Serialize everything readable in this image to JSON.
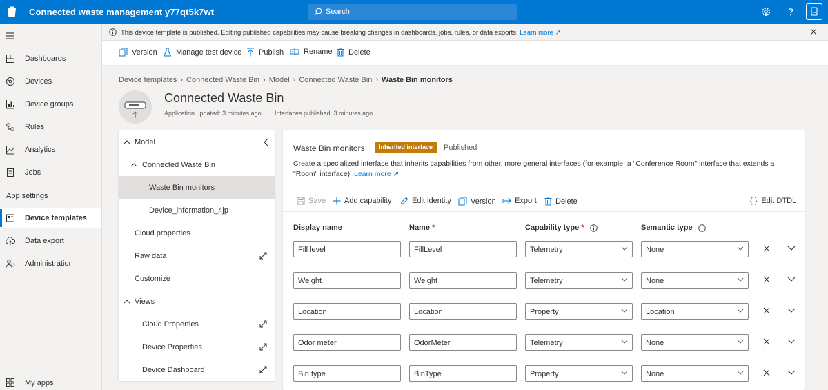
{
  "app": {
    "title": "Connected waste management y77qt5k7wt",
    "search_placeholder": "Search",
    "brand_color": "#0078d4"
  },
  "topbar_icons": [
    "gear-icon",
    "help-icon",
    "user-avatar-icon"
  ],
  "nav": {
    "items": [
      {
        "label": "Dashboards",
        "icon": "dashboard-icon"
      },
      {
        "label": "Devices",
        "icon": "devices-icon"
      },
      {
        "label": "Device groups",
        "icon": "device-groups-icon"
      },
      {
        "label": "Rules",
        "icon": "rules-icon"
      },
      {
        "label": "Analytics",
        "icon": "analytics-icon"
      },
      {
        "label": "Jobs",
        "icon": "jobs-icon"
      }
    ],
    "section_header": "App settings",
    "settings_items": [
      {
        "label": "Device templates",
        "icon": "device-templates-icon",
        "active": true
      },
      {
        "label": "Data export",
        "icon": "data-export-icon"
      },
      {
        "label": "Administration",
        "icon": "administration-icon"
      }
    ],
    "bottom_item": {
      "label": "My apps",
      "icon": "my-apps-icon"
    }
  },
  "notice": {
    "text": "This device template is published. Editing published capabilities may cause breaking changes in dashboards, jobs, rules, or data exports.",
    "link": "Learn more"
  },
  "commands": {
    "version": "Version",
    "manage_test_device": "Manage test device",
    "publish": "Publish",
    "rename": "Rename",
    "delete": "Delete"
  },
  "breadcrumb": [
    "Device templates",
    "Connected Waste Bin",
    "Model",
    "Connected Waste Bin",
    "Waste Bin monitors"
  ],
  "template": {
    "title": "Connected Waste Bin",
    "app_updated": "Application updated: 3 minutes ago",
    "interfaces_published": "Interfaces published: 3 minutes ago"
  },
  "tree": {
    "model": "Model",
    "interface": "Connected Waste Bin",
    "monitors": "Waste Bin monitors",
    "device_info": "Device_information_4jp",
    "cloud_properties": "Cloud properties",
    "raw_data": "Raw data",
    "customize": "Customize",
    "views": "Views",
    "view_cloud_properties": "Cloud Properties",
    "view_device_properties": "Device Properties",
    "view_device_dashboard": "Device Dashboard"
  },
  "editor": {
    "title": "Waste Bin monitors",
    "badge": "Inherited interface",
    "status": "Published",
    "description": "Create a specialized interface that inherits capabilities from other, more general interfaces (for example, a \"Conference Room\" interface that extends a \"Room\" interface).",
    "learn_more": "Learn more",
    "commands": {
      "save": "Save",
      "add_capability": "Add capability",
      "edit_identity": "Edit identity",
      "version": "Version",
      "export": "Export",
      "delete": "Delete",
      "edit_dtdl": "Edit DTDL"
    },
    "columns": {
      "display_name": "Display name",
      "name": "Name",
      "capability_type": "Capability type",
      "semantic_type": "Semantic type",
      "required_mark": "*"
    },
    "rows": [
      {
        "display_name": "Fill level",
        "name": "FillLevel",
        "capability_type": "Telemetry",
        "semantic_type": "None"
      },
      {
        "display_name": "Weight",
        "name": "Weight",
        "capability_type": "Telemetry",
        "semantic_type": "None"
      },
      {
        "display_name": "Location",
        "name": "Location",
        "capability_type": "Property",
        "semantic_type": "Location"
      },
      {
        "display_name": "Odor meter",
        "name": "OdorMeter",
        "capability_type": "Telemetry",
        "semantic_type": "None"
      },
      {
        "display_name": "Bin type",
        "name": "BinType",
        "capability_type": "Property",
        "semantic_type": "None"
      }
    ]
  }
}
